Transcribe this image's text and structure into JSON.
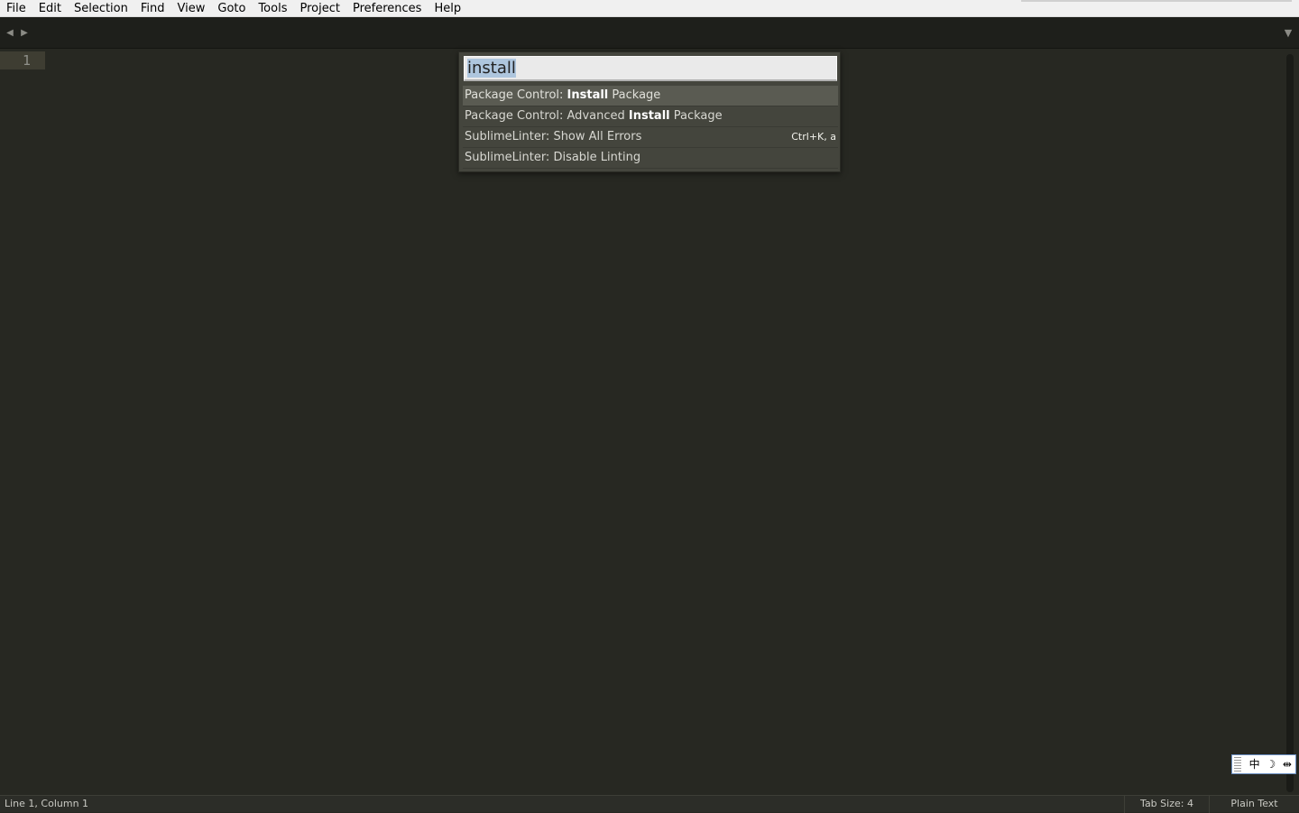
{
  "menu": [
    "File",
    "Edit",
    "Selection",
    "Find",
    "View",
    "Goto",
    "Tools",
    "Project",
    "Preferences",
    "Help"
  ],
  "tabbar": {
    "nav_left": "◀",
    "nav_right": "▶",
    "dropdown": "▼"
  },
  "editor": {
    "line_numbers": [
      "1"
    ]
  },
  "palette": {
    "query": "install",
    "items": [
      {
        "prefix": "Package Control: ",
        "match": "Install",
        "suffix": " Package",
        "shortcut": "",
        "selected": true
      },
      {
        "prefix": "Package Control: Advanced ",
        "match": "Install",
        "suffix": " Package",
        "shortcut": "",
        "selected": false
      },
      {
        "prefix": "SublimeLinter: Show All Errors",
        "match": "",
        "suffix": "",
        "shortcut": "Ctrl+K, a",
        "selected": false
      },
      {
        "prefix": "SublimeLinter: Disable Linting",
        "match": "",
        "suffix": "",
        "shortcut": "",
        "selected": false
      }
    ]
  },
  "statusbar": {
    "position": "Line 1, Column 1",
    "tab_size": "Tab Size: 4",
    "syntax": "Plain Text"
  },
  "ime": {
    "mode": "中",
    "punct": "☽",
    "width": "⇹"
  },
  "colors": {
    "editor_bg": "#272822",
    "palette_bg": "#44453d",
    "selection_highlight": "#aec6de"
  }
}
